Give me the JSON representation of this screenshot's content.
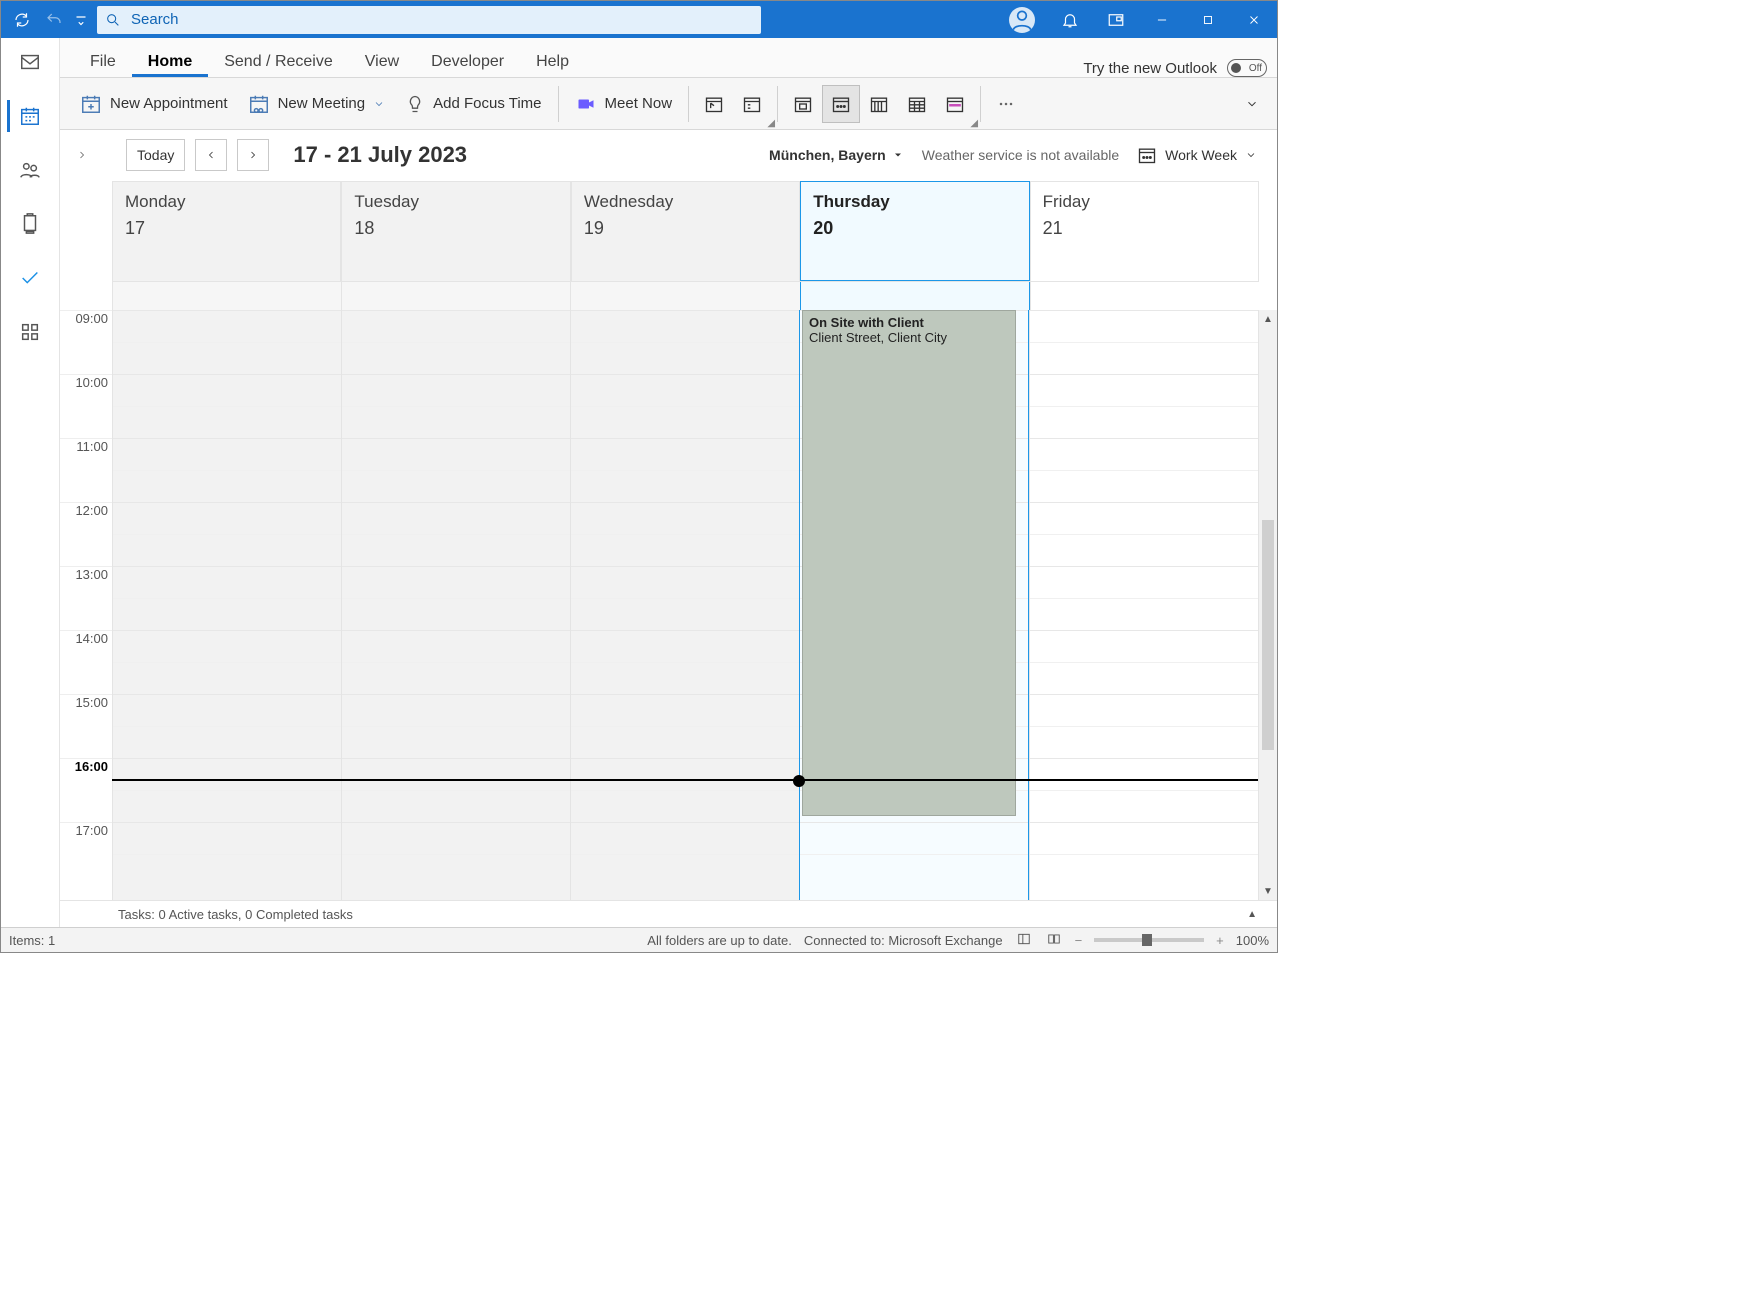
{
  "titlebar": {
    "search_placeholder": "Search"
  },
  "tabs": [
    "File",
    "Home",
    "Send / Receive",
    "View",
    "Developer",
    "Help"
  ],
  "active_tab": "Home",
  "try_new": "Try the new Outlook",
  "toggle_label": "Off",
  "ribbon": {
    "new_appt": "New Appointment",
    "new_meeting": "New Meeting",
    "add_focus": "Add Focus Time",
    "meet_now": "Meet Now"
  },
  "today_btn": "Today",
  "date_range": "17 - 21 July 2023",
  "location": "München, Bayern",
  "weather": "Weather service is not available",
  "view_mode": "Work Week",
  "days": [
    {
      "name": "Monday",
      "num": "17",
      "today": false
    },
    {
      "name": "Tuesday",
      "num": "18",
      "today": false
    },
    {
      "name": "Wednesday",
      "num": "19",
      "today": false
    },
    {
      "name": "Thursday",
      "num": "20",
      "today": true
    },
    {
      "name": "Friday",
      "num": "21",
      "today": false
    }
  ],
  "hours": [
    "09:00",
    "10:00",
    "11:00",
    "12:00",
    "13:00",
    "14:00",
    "15:00",
    "16:00",
    "17:00"
  ],
  "bold_hour": "16:00",
  "event": {
    "title": "On Site with Client",
    "loc": "Client Street, Client City"
  },
  "tasks_line": "Tasks: 0 Active tasks, 0 Completed tasks",
  "status": {
    "items": "Items: 1",
    "folders": "All folders are up to date.",
    "connected": "Connected to: Microsoft Exchange",
    "zoom": "100%"
  }
}
